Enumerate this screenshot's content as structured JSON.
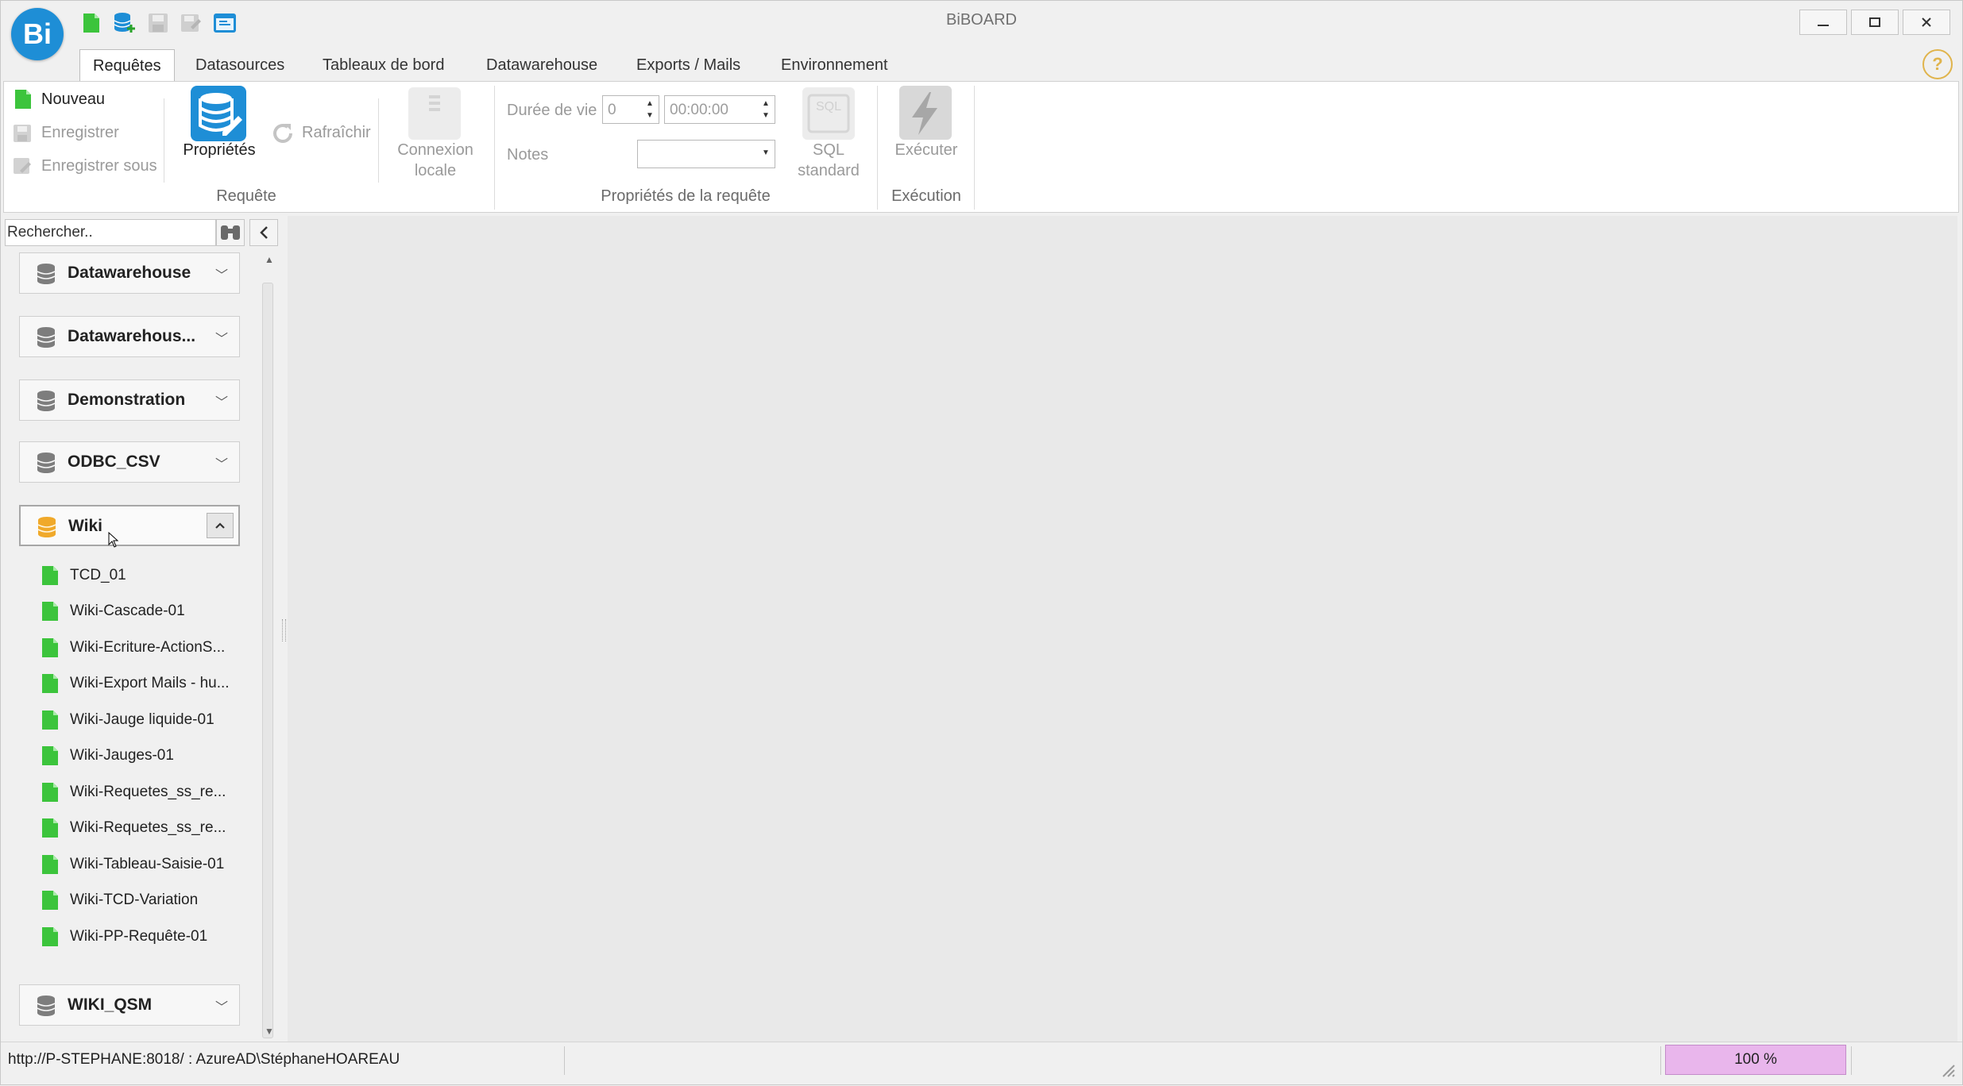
{
  "app": {
    "title": "BiBOARD",
    "logo_text": "Bi"
  },
  "quick_access": [
    "new-doc-icon",
    "add-datasource-icon",
    "save-icon",
    "save-as-icon",
    "window-icon"
  ],
  "tabs": [
    {
      "label": "Requêtes",
      "active": true
    },
    {
      "label": "Datasources"
    },
    {
      "label": "Tableaux de bord"
    },
    {
      "label": "Datawarehouse"
    },
    {
      "label": "Exports / Mails"
    },
    {
      "label": "Environnement"
    }
  ],
  "help": "?",
  "ribbon": {
    "requete": {
      "nouveau": "Nouveau",
      "enregistrer": "Enregistrer",
      "enregistrer_sous": "Enregistrer sous",
      "proprietes": "Propriétés",
      "rafraichir": "Rafraîchir",
      "connexion_line1": "Connexion",
      "connexion_line2": "locale",
      "group_label": "Requête"
    },
    "props": {
      "duree_label": "Durée de vie",
      "duree_value": "0",
      "time_value": "00:00:00",
      "notes_label": "Notes",
      "notes_value": "",
      "sql_icon_text": "SQL",
      "sql_line1": "SQL",
      "sql_line2": "standard",
      "group_label": "Propriétés de la requête"
    },
    "execution": {
      "executer": "Exécuter",
      "group_label": "Exécution"
    }
  },
  "sidebar": {
    "search_placeholder": "Rechercher..",
    "groups": [
      {
        "name": "Datawarehouse"
      },
      {
        "name": "Datawarehous..."
      },
      {
        "name": "Demonstration"
      },
      {
        "name": "ODBC_CSV"
      },
      {
        "name": "Wiki",
        "expanded": true,
        "items": [
          "TCD_01",
          "Wiki-Cascade-01",
          "Wiki-Ecriture-ActionS...",
          "Wiki-Export Mails - hu...",
          "Wiki-Jauge liquide-01",
          "Wiki-Jauges-01",
          "Wiki-Requetes_ss_re...",
          "Wiki-Requetes_ss_re...",
          "Wiki-Tableau-Saisie-01",
          "Wiki-TCD-Variation",
          "Wiki-PP-Requête-01"
        ]
      },
      {
        "name": "WIKI_QSM"
      }
    ]
  },
  "statusbar": {
    "connection": "http://P-STEPHANE:8018/ : AzureAD\\StéphaneHOAREAU",
    "zoom": "100 %"
  },
  "colors": {
    "accent": "#1e8ed6",
    "doc_green": "#3cc43c",
    "wiki_db": "#f0a92a",
    "zoom_bg": "#e9b6ec"
  }
}
